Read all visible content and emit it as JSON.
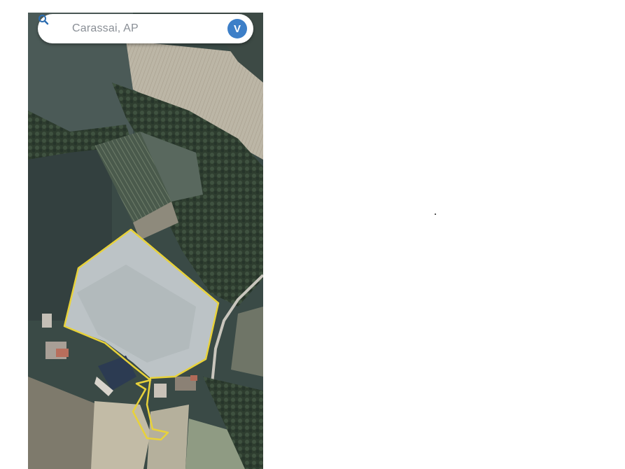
{
  "search": {
    "query": "Carassai, AP",
    "icon": "search-icon"
  },
  "account": {
    "avatar_letter": "V",
    "avatar_color": "#3d7fc8"
  },
  "map": {
    "view": "satellite",
    "parcel_outline_color": "#e8d23a"
  }
}
